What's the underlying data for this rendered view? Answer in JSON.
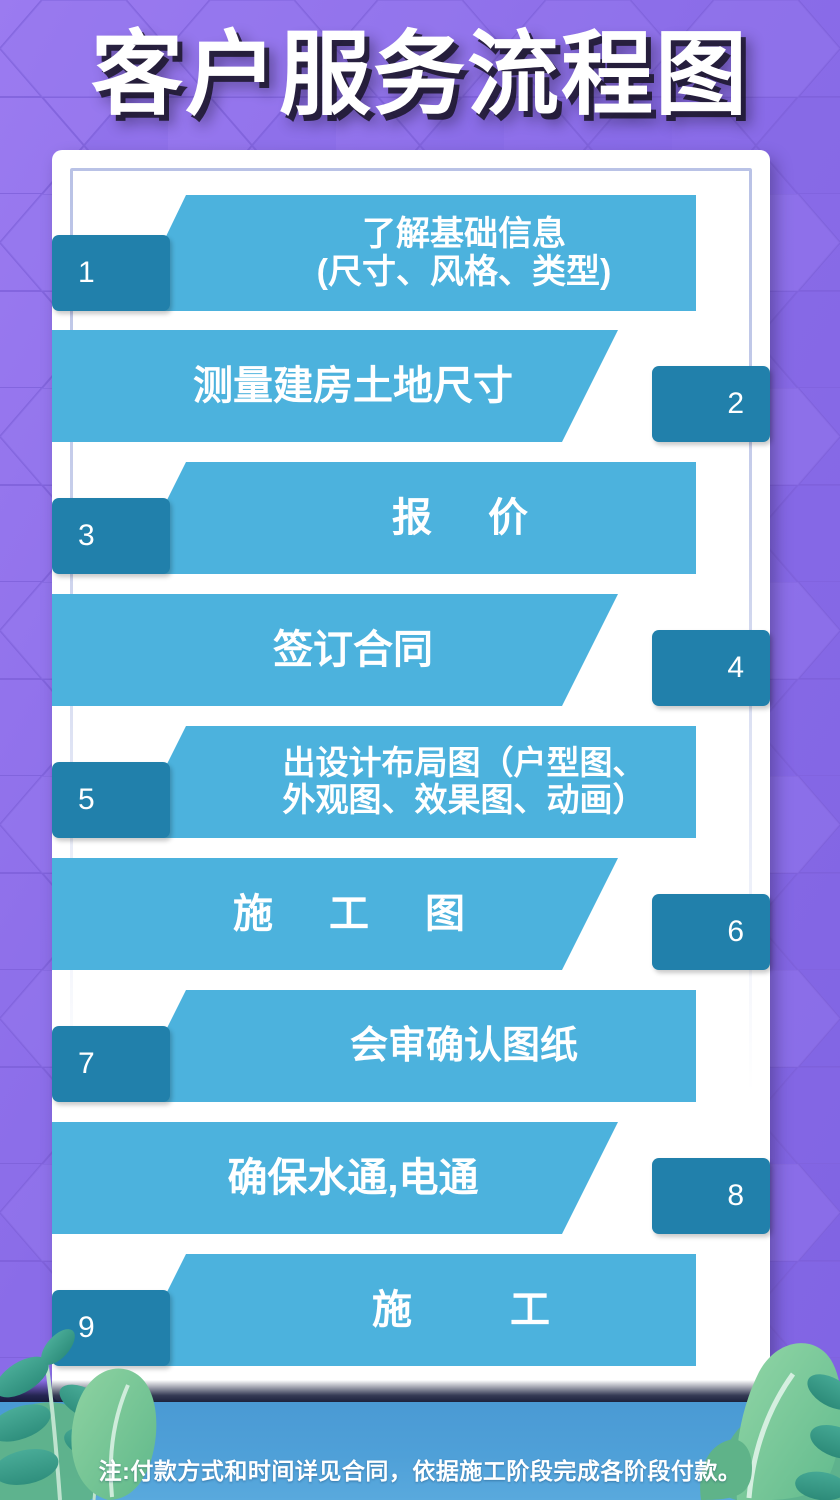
{
  "title": "客户服务流程图",
  "theme": {
    "bg_purple": "#8b6fe9",
    "band_light_blue": "#4CB2DD",
    "badge_dark_blue": "#2180AB",
    "card_white": "#ffffff",
    "card_inner_border": "#b9c2e6",
    "footer_blue": "#4a9ad4",
    "text_white": "#ffffff",
    "leaf_green": "#7cc48f",
    "leaf_teal": "#3fa38f"
  },
  "steps": [
    {
      "number": "1",
      "label": "了解基础信息\n(尺寸、风格、类型)",
      "badge_side": "left",
      "lines": 2
    },
    {
      "number": "2",
      "label": "测量建房土地尺寸",
      "badge_side": "right",
      "lines": 1
    },
    {
      "number": "3",
      "label": "报　价",
      "badge_side": "left",
      "lines": 1
    },
    {
      "number": "4",
      "label": "签订合同",
      "badge_side": "right",
      "lines": 1
    },
    {
      "number": "5",
      "label": "出设计布局图（户型图、\n外观图、效果图、动画）",
      "badge_side": "left",
      "lines": 2
    },
    {
      "number": "6",
      "label": "施　工　图",
      "badge_side": "right",
      "lines": 1
    },
    {
      "number": "7",
      "label": "会审确认图纸",
      "badge_side": "left",
      "lines": 1
    },
    {
      "number": "8",
      "label": "确保水通,电通",
      "badge_side": "right",
      "lines": 1
    },
    {
      "number": "9",
      "label": "施　　工",
      "badge_side": "left",
      "lines": 1
    }
  ],
  "footer": {
    "note": "注:付款方式和时间详见合同，依据施工阶段完成各阶段付款。"
  }
}
